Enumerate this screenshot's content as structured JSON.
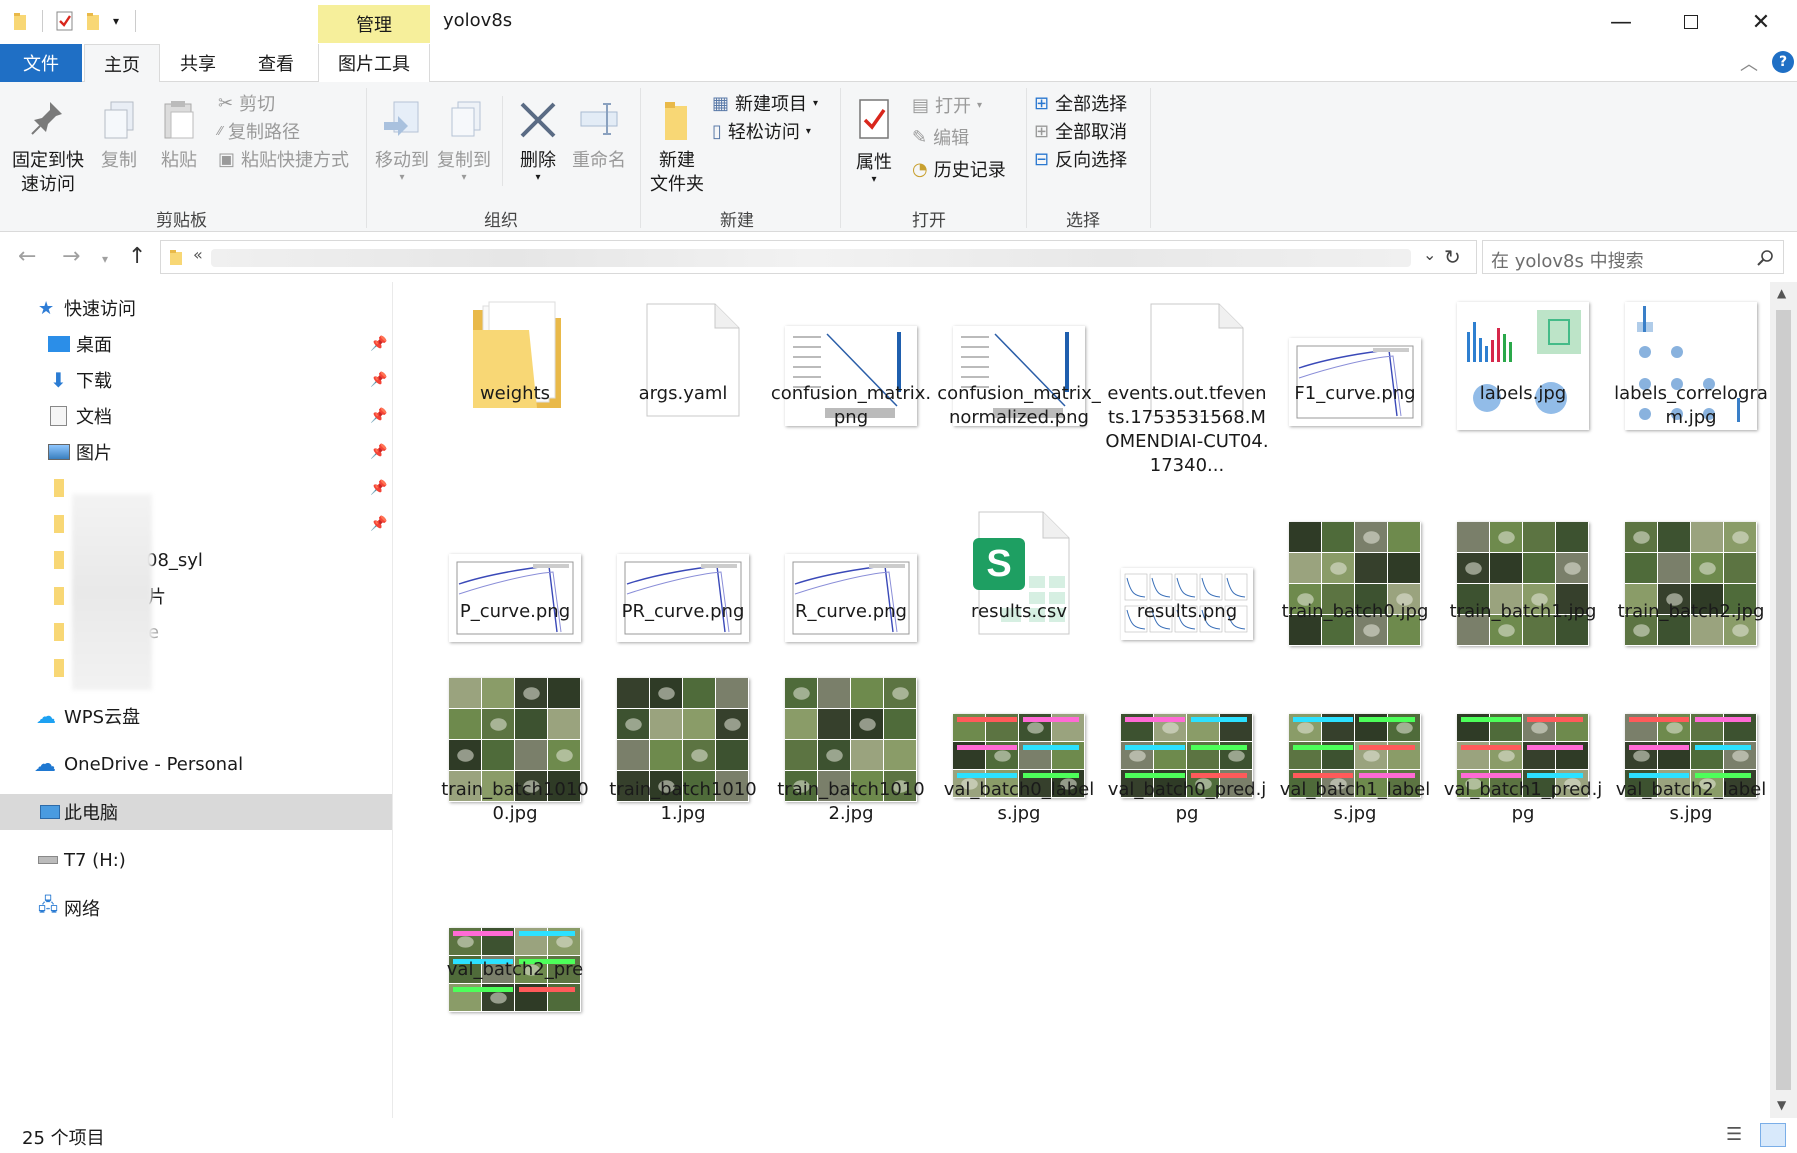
{
  "window": {
    "title": "yolov8s",
    "context_tab": "管理"
  },
  "tabs": [
    "文件",
    "主页",
    "共享",
    "查看",
    "图片工具"
  ],
  "ribbon": {
    "clipboard": {
      "pin": "固定到快\n速访问",
      "copy": "复制",
      "paste": "粘贴",
      "cut": "剪切",
      "copy_path": "复制路径",
      "paste_shortcut": "粘贴快捷方式",
      "label": "剪贴板"
    },
    "organize": {
      "move_to": "移动到",
      "copy_to": "复制到",
      "delete": "删除",
      "rename": "重命名",
      "label": "组织"
    },
    "new": {
      "new_folder": "新建\n文件夹",
      "new_item": "新建项目",
      "easy_access": "轻松访问",
      "label": "新建"
    },
    "open": {
      "properties": "属性",
      "open": "打开",
      "edit": "编辑",
      "history": "历史记录",
      "label": "打开"
    },
    "select": {
      "select_all": "全部选择",
      "select_none": "全部取消",
      "invert": "反向选择",
      "label": "选择"
    }
  },
  "address": {
    "chevron": "«"
  },
  "search": {
    "placeholder": "在 yolov8s 中搜索"
  },
  "nav": {
    "quick_access": "快速访问",
    "desktop": "桌面",
    "downloads": "下载",
    "documents": "文档",
    "pictures": "图片",
    "blurred1": "08_syl",
    "blurred2": "片",
    "blurred3": "e",
    "wps": "WPS云盘",
    "onedrive": "OneDrive - Personal",
    "thispc": "此电脑",
    "t7": "T7 (H:)",
    "network": "网络"
  },
  "files": [
    {
      "name": "weights",
      "type": "folder"
    },
    {
      "name": "args.yaml",
      "type": "blank"
    },
    {
      "name": "confusion_matrix.png",
      "type": "matrix"
    },
    {
      "name": "confusion_matrix_normalized.png",
      "type": "matrix"
    },
    {
      "name": "events.out.tfevents.1753531568.MOMENDIAI-CUT04.17340...",
      "type": "blank"
    },
    {
      "name": "F1_curve.png",
      "type": "curve"
    },
    {
      "name": "labels.jpg",
      "type": "labels"
    },
    {
      "name": "labels_correlogram.jpg",
      "type": "correlogram"
    },
    {
      "name": "P_curve.png",
      "type": "curve"
    },
    {
      "name": "PR_curve.png",
      "type": "curve"
    },
    {
      "name": "R_curve.png",
      "type": "curve"
    },
    {
      "name": "results.csv",
      "type": "csv"
    },
    {
      "name": "results.png",
      "type": "results"
    },
    {
      "name": "train_batch0.jpg",
      "type": "photo"
    },
    {
      "name": "train_batch1.jpg",
      "type": "photo"
    },
    {
      "name": "train_batch2.jpg",
      "type": "photo"
    },
    {
      "name": "train_batch10100.jpg",
      "type": "photo"
    },
    {
      "name": "train_batch10101.jpg",
      "type": "photo"
    },
    {
      "name": "train_batch10102.jpg",
      "type": "photo"
    },
    {
      "name": "val_batch0_labels.jpg",
      "type": "valphoto"
    },
    {
      "name": "val_batch0_pred.jpg",
      "type": "valphoto"
    },
    {
      "name": "val_batch1_labels.jpg",
      "type": "valphoto"
    },
    {
      "name": "val_batch1_pred.jpg",
      "type": "valphoto"
    },
    {
      "name": "val_batch2_labels.jpg",
      "type": "valphoto"
    },
    {
      "name": "val_batch2_pre",
      "type": "valphoto"
    }
  ],
  "status": {
    "count": "25 个项目"
  },
  "colors": {
    "accent": "#1f6fc5",
    "context": "#f6ef9b",
    "folder": "#f8d775"
  }
}
